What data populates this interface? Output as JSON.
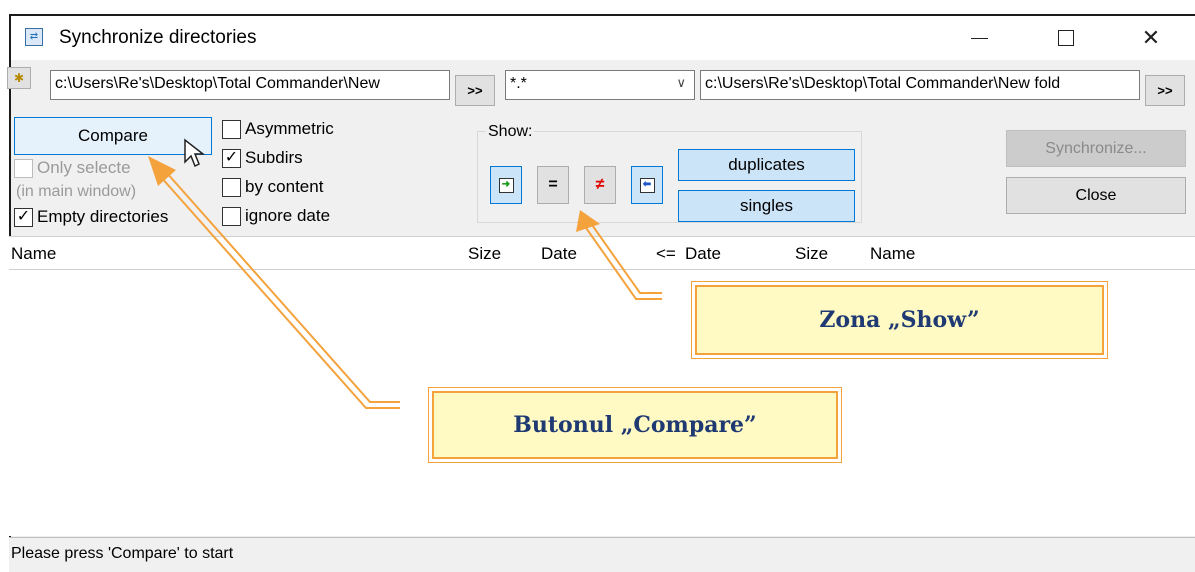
{
  "window": {
    "title": "Synchronize directories",
    "controls": [
      "minimize",
      "maximize",
      "close"
    ]
  },
  "paths": {
    "left": "c:\\Users\\Re's\\Desktop\\Total Commander\\New",
    "left_arrow_btn": ">>",
    "filter": "*.*",
    "right": "c:\\Users\\Re's\\Desktop\\Total Commander\\New fold",
    "right_arrow_btn": ">>"
  },
  "options": {
    "compare_button": "Compare",
    "only_selected": {
      "label": "Only selecte",
      "checked": false,
      "enabled": false
    },
    "in_main_window": "(in main window)",
    "empty_directories": {
      "label": "Empty directories",
      "checked": true
    },
    "asymmetric": {
      "label": "Asymmetric",
      "checked": false
    },
    "subdirs": {
      "label": "Subdirs",
      "checked": true
    },
    "by_content": {
      "label": "by content",
      "checked": false
    },
    "ignore_date": {
      "label": "ignore date",
      "checked": false
    }
  },
  "show": {
    "label": "Show:",
    "buttons": [
      "left-to-right",
      "=",
      "≠",
      "right-to-left"
    ],
    "duplicates": "duplicates",
    "singles": "singles"
  },
  "actions": {
    "synchronize": "Synchronize...",
    "close": "Close"
  },
  "columns": {
    "name_left": "Name",
    "size_left": "Size",
    "date_left": "Date",
    "compare": "<=",
    "date_right": "Date",
    "size_right": "Size",
    "name_right": "Name"
  },
  "status": "Please press 'Compare' to start",
  "annotations": {
    "show_zone": "Zona „Show”",
    "compare_button": "Butonul „Compare”"
  },
  "colors": {
    "accent": "#0078d7",
    "callout_fill": "#fff9c4",
    "callout_border": "#f4a23c",
    "callout_text": "#1f3a73"
  }
}
